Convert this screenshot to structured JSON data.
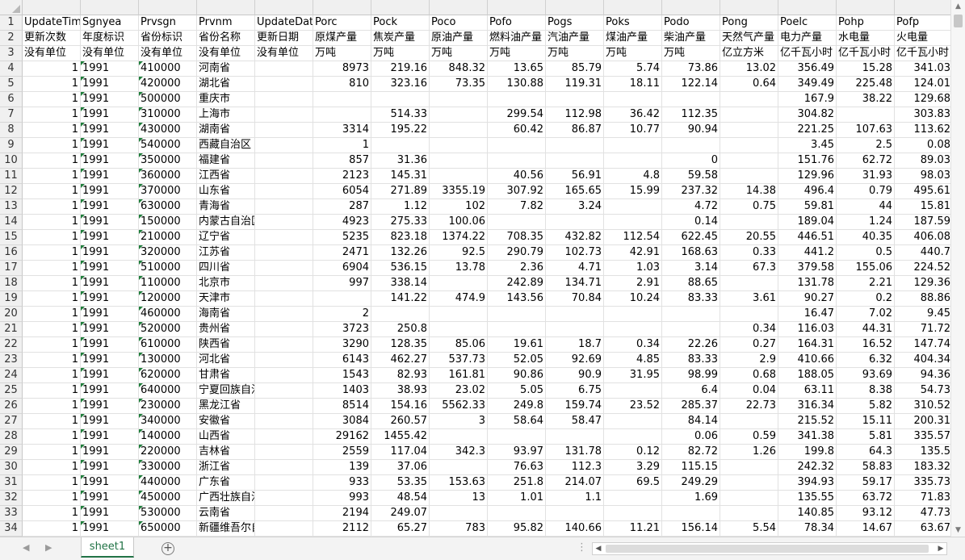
{
  "sheet": {
    "columns": [
      "A",
      "B",
      "C",
      "D",
      "E",
      "F",
      "G",
      "H",
      "I",
      "J",
      "K",
      "L",
      "M",
      "N",
      "O",
      "P"
    ],
    "headers": [
      [
        "UpdateTim",
        "Sgnyea",
        "Prvsgn",
        "Prvnm",
        "UpdateDat",
        "Porc",
        "Pock",
        "Poco",
        "Pofo",
        "Pogs",
        "Poks",
        "Podo",
        "Pong",
        "Poelc",
        "Pohp",
        "Pofp"
      ],
      [
        "更新次数",
        "年度标识",
        "省份标识",
        "省份名称",
        "更新日期",
        "原煤产量",
        "焦炭产量",
        "原油产量",
        "燃料油产量",
        "汽油产量",
        "煤油产量",
        "柴油产量",
        "天然气产量",
        "电力产量",
        "水电量",
        "火电量"
      ],
      [
        "没有单位",
        "没有单位",
        "没有单位",
        "没有单位",
        "没有单位",
        "万吨",
        "万吨",
        "万吨",
        "万吨",
        "万吨",
        "万吨",
        "万吨",
        "亿立方米",
        "亿千瓦小时",
        "亿千瓦小时",
        "亿千瓦小时"
      ]
    ],
    "data": [
      [
        "1",
        "1991",
        "410000",
        "河南省",
        "",
        "8973",
        "219.16",
        "848.32",
        "13.65",
        "85.79",
        "5.74",
        "73.86",
        "13.02",
        "356.49",
        "15.28",
        "341.03"
      ],
      [
        "1",
        "1991",
        "420000",
        "湖北省",
        "",
        "810",
        "323.16",
        "73.35",
        "130.88",
        "119.31",
        "18.11",
        "122.14",
        "0.64",
        "349.49",
        "225.48",
        "124.01"
      ],
      [
        "1",
        "1991",
        "500000",
        "重庆市",
        "",
        "",
        "",
        "",
        "",
        "",
        "",
        "",
        "",
        "167.9",
        "38.22",
        "129.68"
      ],
      [
        "1",
        "1991",
        "310000",
        "上海市",
        "",
        "",
        "514.33",
        "",
        "299.54",
        "112.98",
        "36.42",
        "112.35",
        "",
        "304.82",
        "",
        "303.83"
      ],
      [
        "1",
        "1991",
        "430000",
        "湖南省",
        "",
        "3314",
        "195.22",
        "",
        "60.42",
        "86.87",
        "10.77",
        "90.94",
        "",
        "221.25",
        "107.63",
        "113.62"
      ],
      [
        "1",
        "1991",
        "540000",
        "西藏自治区",
        "",
        "1",
        "",
        "",
        "",
        "",
        "",
        "",
        "",
        "3.45",
        "2.5",
        "0.08"
      ],
      [
        "1",
        "1991",
        "350000",
        "福建省",
        "",
        "857",
        "31.36",
        "",
        "",
        "",
        "",
        "0",
        "",
        "151.76",
        "62.72",
        "89.03"
      ],
      [
        "1",
        "1991",
        "360000",
        "江西省",
        "",
        "2123",
        "145.31",
        "",
        "40.56",
        "56.91",
        "4.8",
        "59.58",
        "",
        "129.96",
        "31.93",
        "98.03"
      ],
      [
        "1",
        "1991",
        "370000",
        "山东省",
        "",
        "6054",
        "271.89",
        "3355.19",
        "307.92",
        "165.65",
        "15.99",
        "237.32",
        "14.38",
        "496.4",
        "0.79",
        "495.61"
      ],
      [
        "1",
        "1991",
        "630000",
        "青海省",
        "",
        "287",
        "1.12",
        "102",
        "7.82",
        "3.24",
        "",
        "4.72",
        "0.75",
        "59.81",
        "44",
        "15.81"
      ],
      [
        "1",
        "1991",
        "150000",
        "内蒙古自治区",
        "",
        "4923",
        "275.33",
        "100.06",
        "",
        "",
        "",
        "0.14",
        "",
        "189.04",
        "1.24",
        "187.59"
      ],
      [
        "1",
        "1991",
        "210000",
        "辽宁省",
        "",
        "5235",
        "823.18",
        "1374.22",
        "708.35",
        "432.82",
        "112.54",
        "622.45",
        "20.55",
        "446.51",
        "40.35",
        "406.08"
      ],
      [
        "1",
        "1991",
        "320000",
        "江苏省",
        "",
        "2471",
        "132.26",
        "92.5",
        "290.79",
        "102.73",
        "42.91",
        "168.63",
        "0.33",
        "441.2",
        "0.5",
        "440.7"
      ],
      [
        "1",
        "1991",
        "510000",
        "四川省",
        "",
        "6904",
        "536.15",
        "13.78",
        "2.36",
        "4.71",
        "1.03",
        "3.14",
        "67.3",
        "379.58",
        "155.06",
        "224.52"
      ],
      [
        "1",
        "1991",
        "110000",
        "北京市",
        "",
        "997",
        "338.14",
        "",
        "242.89",
        "134.71",
        "2.91",
        "88.65",
        "",
        "131.78",
        "2.21",
        "129.36"
      ],
      [
        "1",
        "1991",
        "120000",
        "天津市",
        "",
        "",
        "141.22",
        "474.9",
        "143.56",
        "70.84",
        "10.24",
        "83.33",
        "3.61",
        "90.27",
        "0.2",
        "88.86"
      ],
      [
        "1",
        "1991",
        "460000",
        "海南省",
        "",
        "2",
        "",
        "",
        "",
        "",
        "",
        "",
        "",
        "16.47",
        "7.02",
        "9.45"
      ],
      [
        "1",
        "1991",
        "520000",
        "贵州省",
        "",
        "3723",
        "250.8",
        "",
        "",
        "",
        "",
        "",
        "0.34",
        "116.03",
        "44.31",
        "71.72"
      ],
      [
        "1",
        "1991",
        "610000",
        "陕西省",
        "",
        "3290",
        "128.35",
        "85.06",
        "19.61",
        "18.7",
        "0.34",
        "22.26",
        "0.27",
        "164.31",
        "16.52",
        "147.74"
      ],
      [
        "1",
        "1991",
        "130000",
        "河北省",
        "",
        "6143",
        "462.27",
        "537.73",
        "52.05",
        "92.69",
        "4.85",
        "83.33",
        "2.9",
        "410.66",
        "6.32",
        "404.34"
      ],
      [
        "1",
        "1991",
        "620000",
        "甘肃省",
        "",
        "1543",
        "82.93",
        "161.81",
        "90.86",
        "90.9",
        "31.95",
        "98.99",
        "0.68",
        "188.05",
        "93.69",
        "94.36"
      ],
      [
        "1",
        "1991",
        "640000",
        "宁夏回族自治区",
        "",
        "1403",
        "38.93",
        "23.02",
        "5.05",
        "6.75",
        "",
        "6.4",
        "0.04",
        "63.11",
        "8.38",
        "54.73"
      ],
      [
        "1",
        "1991",
        "230000",
        "黑龙江省",
        "",
        "8514",
        "154.16",
        "5562.33",
        "249.8",
        "159.74",
        "23.52",
        "285.37",
        "22.73",
        "316.34",
        "5.82",
        "310.52"
      ],
      [
        "1",
        "1991",
        "340000",
        "安徽省",
        "",
        "3084",
        "260.57",
        "3",
        "58.64",
        "58.47",
        "",
        "84.14",
        "",
        "215.52",
        "15.11",
        "200.31"
      ],
      [
        "1",
        "1991",
        "140000",
        "山西省",
        "",
        "29162",
        "1455.42",
        "",
        "",
        "",
        "",
        "0.06",
        "0.59",
        "341.38",
        "5.81",
        "335.57"
      ],
      [
        "1",
        "1991",
        "220000",
        "吉林省",
        "",
        "2559",
        "117.04",
        "342.3",
        "93.97",
        "131.78",
        "0.12",
        "82.72",
        "1.26",
        "199.8",
        "64.3",
        "135.5"
      ],
      [
        "1",
        "1991",
        "330000",
        "浙江省",
        "",
        "139",
        "37.06",
        "",
        "76.63",
        "112.3",
        "3.29",
        "115.15",
        "",
        "242.32",
        "58.83",
        "183.32"
      ],
      [
        "1",
        "1991",
        "440000",
        "广东省",
        "",
        "933",
        "53.35",
        "153.63",
        "251.8",
        "214.07",
        "69.5",
        "249.29",
        "",
        "394.93",
        "59.17",
        "335.73"
      ],
      [
        "1",
        "1991",
        "450000",
        "广西壮族自治区",
        "",
        "993",
        "48.54",
        "13",
        "1.01",
        "1.1",
        "",
        "1.69",
        "",
        "135.55",
        "63.72",
        "71.83"
      ],
      [
        "1",
        "1991",
        "530000",
        "云南省",
        "",
        "2194",
        "249.07",
        "",
        "",
        "",
        "",
        "",
        "",
        "140.85",
        "93.12",
        "47.73"
      ],
      [
        "1",
        "1991",
        "650000",
        "新疆维吾尔自治区",
        "",
        "2112",
        "65.27",
        "783",
        "95.82",
        "140.66",
        "11.21",
        "156.14",
        "5.54",
        "78.34",
        "14.67",
        "63.67"
      ]
    ]
  },
  "tabs": [
    {
      "label": "sheet1",
      "active": true
    }
  ],
  "ui": {
    "add_sheet_symbol": "+",
    "more_symbol": "⋮",
    "accent_color": "#217346",
    "flag_color": "#1e7d3a"
  }
}
